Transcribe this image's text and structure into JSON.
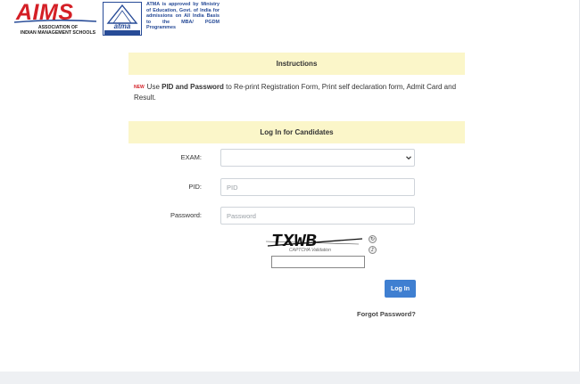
{
  "header": {
    "aims_logo_text": "AIMS",
    "aims_subtitle_line1": "ASSOCIATION OF",
    "aims_subtitle_line2": "INDIAN MANAGEMENT SCHOOLS",
    "atma_logo_text": "atma",
    "approval_text": "ATMA is approved by Ministry of Education, Govt. of India for admissions on All India Basis to the MBA/ PGDM Programmes",
    "brand_color": "#d41f26",
    "atma_color": "#274b97"
  },
  "instructions": {
    "title": "Instructions",
    "new_badge": "NEW",
    "text_prefix": "Use ",
    "text_bold": "PID and Password",
    "text_suffix": " to Re-print Registration Form, Print self declaration form, Admit Card and Result."
  },
  "login": {
    "title": "Log In for Candidates",
    "exam_label": "EXAM:",
    "exam_selected": "",
    "pid_label": "PID:",
    "pid_placeholder": "PID",
    "password_label": "Password:",
    "password_placeholder": "Password",
    "captcha_text": "TXWB",
    "captcha_caption": "CAPTCHA Validation",
    "captcha_value": "",
    "login_button": "Log In",
    "forgot_link": "Forgot Password?",
    "button_color": "#3f7fd1",
    "panel_color": "#fbf6c9"
  }
}
